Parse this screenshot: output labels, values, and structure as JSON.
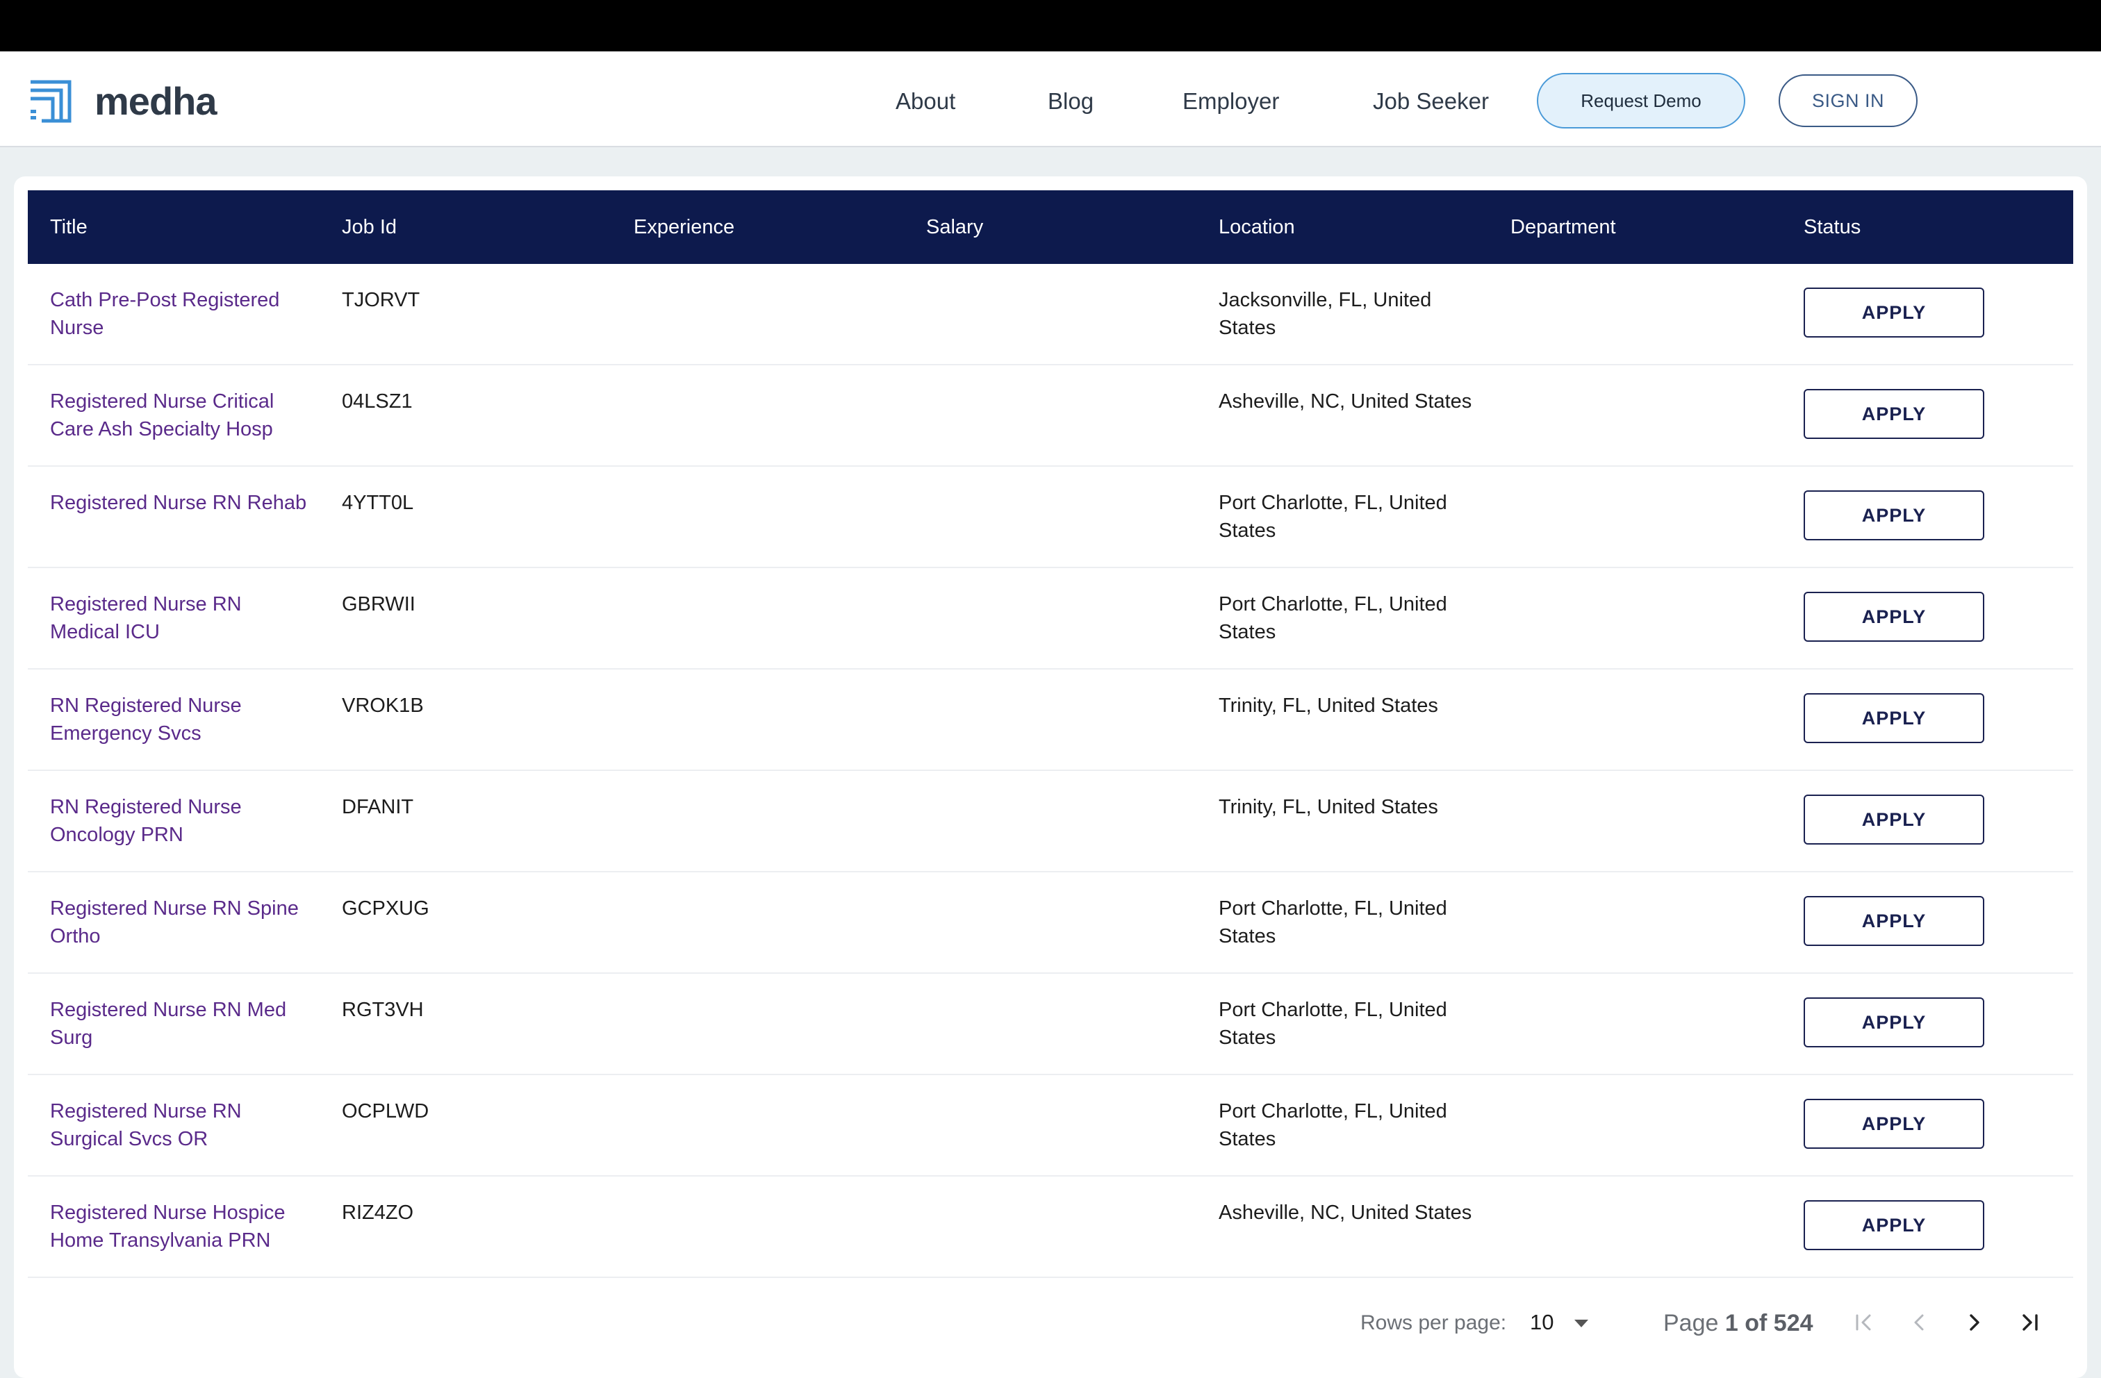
{
  "brand": {
    "name": "medha",
    "logo_icon": "medha-logo-icon",
    "accent": "#3a8fd6"
  },
  "nav": {
    "links": [
      "About",
      "Blog",
      "Employer",
      "Job Seeker"
    ],
    "request_demo": "Request Demo",
    "sign_in": "SIGN IN"
  },
  "table": {
    "columns": [
      "Title",
      "Job Id",
      "Experience",
      "Salary",
      "Location",
      "Department",
      "Status"
    ],
    "header_color": "#0d1a4d",
    "title_color": "#5a2a8a",
    "rows": [
      {
        "title": "Cath Pre-Post Registered Nurse",
        "job_id": "TJORVT",
        "experience": "",
        "salary": "",
        "location": "Jacksonville, FL, United States",
        "department": "",
        "status": "APPLY"
      },
      {
        "title": "Registered Nurse Critical Care Ash Specialty Hosp",
        "job_id": "04LSZ1",
        "experience": "",
        "salary": "",
        "location": "Asheville, NC, United States",
        "department": "",
        "status": "APPLY"
      },
      {
        "title": "Registered Nurse RN Rehab",
        "job_id": "4YTT0L",
        "experience": "",
        "salary": "",
        "location": "Port Charlotte, FL, United States",
        "department": "",
        "status": "APPLY"
      },
      {
        "title": "Registered Nurse RN Medical ICU",
        "job_id": "GBRWII",
        "experience": "",
        "salary": "",
        "location": "Port Charlotte, FL, United States",
        "department": "",
        "status": "APPLY"
      },
      {
        "title": "RN Registered Nurse Emergency Svcs",
        "job_id": "VROK1B",
        "experience": "",
        "salary": "",
        "location": "Trinity, FL, United States",
        "department": "",
        "status": "APPLY"
      },
      {
        "title": "RN Registered Nurse Oncology PRN",
        "job_id": "DFANIT",
        "experience": "",
        "salary": "",
        "location": "Trinity, FL, United States",
        "department": "",
        "status": "APPLY"
      },
      {
        "title": "Registered Nurse RN Spine Ortho",
        "job_id": "GCPXUG",
        "experience": "",
        "salary": "",
        "location": "Port Charlotte, FL, United States",
        "department": "",
        "status": "APPLY"
      },
      {
        "title": "Registered Nurse RN Med Surg",
        "job_id": "RGT3VH",
        "experience": "",
        "salary": "",
        "location": "Port Charlotte, FL, United States",
        "department": "",
        "status": "APPLY"
      },
      {
        "title": "Registered Nurse RN Surgical Svcs OR",
        "job_id": "OCPLWD",
        "experience": "",
        "salary": "",
        "location": "Port Charlotte, FL, United States",
        "department": "",
        "status": "APPLY"
      },
      {
        "title": "Registered Nurse Hospice Home Transylvania PRN",
        "job_id": "RIZ4ZO",
        "experience": "",
        "salary": "",
        "location": "Asheville, NC, United States",
        "department": "",
        "status": "APPLY"
      }
    ]
  },
  "pagination": {
    "rows_per_page_label": "Rows per page:",
    "rows_per_page": "10",
    "page_prefix": "Page",
    "page_current": "1",
    "page_of_label": "of",
    "page_total": "524",
    "icons": [
      "first-page-icon",
      "previous-page-icon",
      "next-page-icon",
      "last-page-icon"
    ]
  }
}
